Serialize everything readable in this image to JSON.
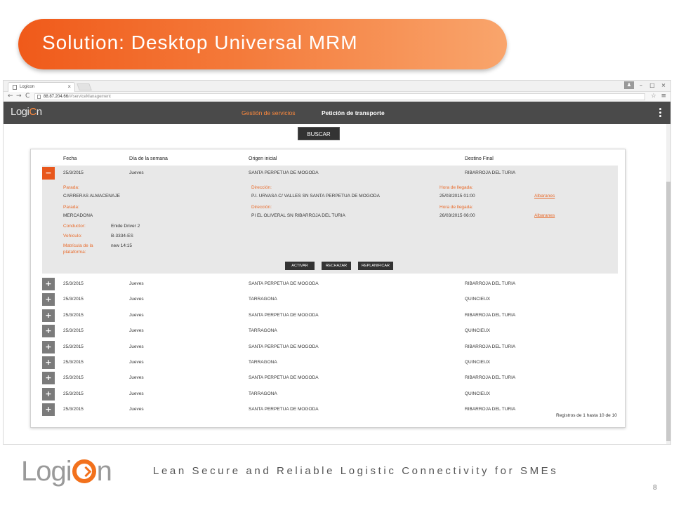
{
  "slide": {
    "title": "Solution: Desktop Universal MRM",
    "tagline": "Lean Secure and Reliable Logistic Connectivity for SMEs",
    "page_number": "8",
    "logo_left": "Logi",
    "logo_right": "n",
    "brand_color": "#f2711c"
  },
  "browser": {
    "tab_title": "Logicon",
    "tab_close": "×",
    "url_host": "88.87.204.66",
    "url_path": "/#/serviceManagement",
    "nav_back": "←",
    "nav_forward": "→",
    "nav_reload": "C",
    "star": "☆",
    "menu": "≡",
    "win_user": "♟",
    "win_min": "–",
    "win_max": "□",
    "win_close": "×"
  },
  "app": {
    "logo_left": "Logi",
    "logo_accent": "C",
    "logo_right": "n",
    "nav": [
      {
        "label": "Gestión de servicios"
      },
      {
        "label": "Petición de transporte"
      }
    ],
    "search_label": "BUSCAR"
  },
  "table": {
    "headers": [
      "Fecha",
      "Día de la semana",
      "Origen inicial",
      "Destino Final"
    ],
    "expanded_row": {
      "fecha": "25/3/2015",
      "dia": "Jueves",
      "origen": "SANTA PERPETUA DE MOGODA",
      "destino": "RIBARROJA DEL TURIA",
      "toggle": "−",
      "stops": [
        {
          "parada_label": "Parada:",
          "parada": "CARRERAS ALMACENAJE",
          "direccion_label": "Dirección:",
          "direccion": "P.I. URVASA C/ VALLES SN SANTA PERPETUA DE MOGODA",
          "hora_label": "Hora de llegada:",
          "hora": "25/03/2015 01:00",
          "link": "Albaranes"
        },
        {
          "parada_label": "Parada:",
          "parada": "MERCADONA",
          "direccion_label": "Dirección:",
          "direccion": "PI EL OLIVERAL SN RIBARROJA DEL TURIA",
          "hora_label": "Hora de llegada:",
          "hora": "26/03/2015 06:00",
          "link": "Albaranes"
        }
      ],
      "conductor_label": "Conductor:",
      "conductor": "Enide Driver 2",
      "vehiculo_label": "Vehículo:",
      "vehiculo": "B-3334-ES",
      "matricula_label_1": "Matrícula de la",
      "matricula_label_2": "plataforma:",
      "matricula": "new 14:15",
      "actions": [
        "ACTIVAR",
        "RECHAZAR",
        "REPLANIFICAR"
      ]
    },
    "rows": [
      {
        "fecha": "25/3/2015",
        "dia": "Jueves",
        "origen": "SANTA PERPETUA DE MOGODA",
        "destino": "RIBARROJA DEL TURIA"
      },
      {
        "fecha": "25/3/2015",
        "dia": "Jueves",
        "origen": "TARRAGONA",
        "destino": "QUINCIEUX"
      },
      {
        "fecha": "25/3/2015",
        "dia": "Jueves",
        "origen": "SANTA PERPETUA DE MOGODA",
        "destino": "RIBARROJA DEL TURIA"
      },
      {
        "fecha": "25/3/2015",
        "dia": "Jueves",
        "origen": "TARRAGONA",
        "destino": "QUINCIEUX"
      },
      {
        "fecha": "25/3/2015",
        "dia": "Jueves",
        "origen": "SANTA PERPETUA DE MOGODA",
        "destino": "RIBARROJA DEL TURIA"
      },
      {
        "fecha": "25/3/2015",
        "dia": "Jueves",
        "origen": "TARRAGONA",
        "destino": "QUINCIEUX"
      },
      {
        "fecha": "25/3/2015",
        "dia": "Jueves",
        "origen": "SANTA PERPETUA DE MOGODA",
        "destino": "RIBARROJA DEL TURIA"
      },
      {
        "fecha": "25/3/2015",
        "dia": "Jueves",
        "origen": "TARRAGONA",
        "destino": "QUINCIEUX"
      },
      {
        "fecha": "25/3/2015",
        "dia": "Jueves",
        "origen": "SANTA PERPETUA DE MOGODA",
        "destino": "RIBARROJA DEL TURIA"
      }
    ],
    "row_toggle": "+",
    "records_summary": "Registros de 1 hasta 10 de 10"
  }
}
